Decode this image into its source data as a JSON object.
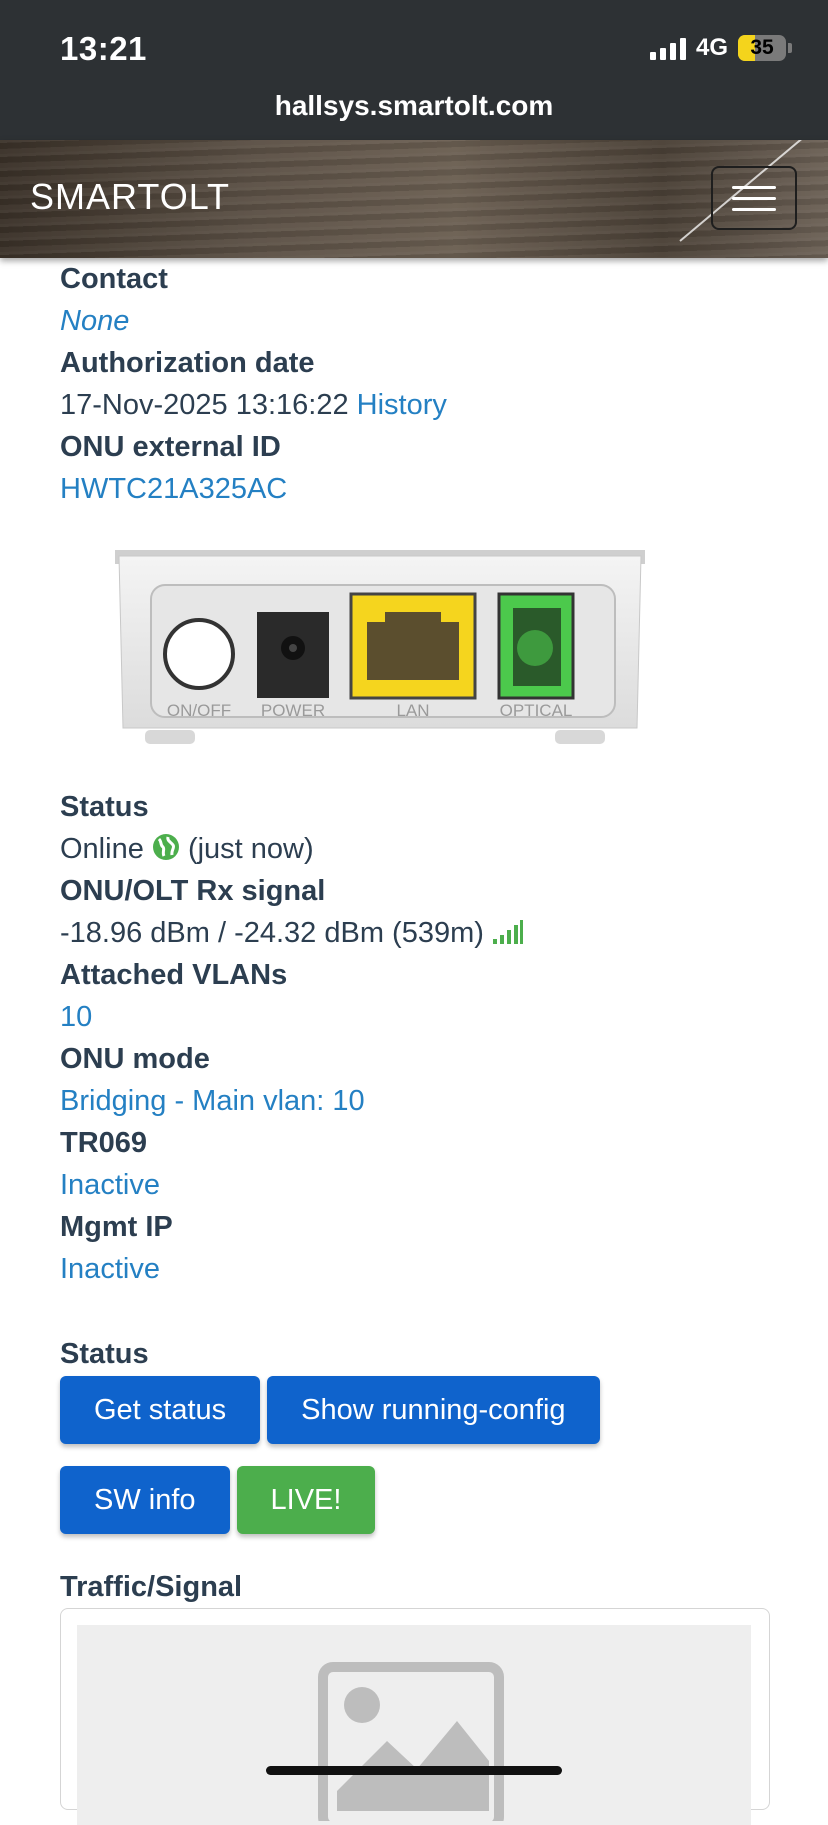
{
  "status_bar": {
    "time": "13:21",
    "network": "4G",
    "battery": "35",
    "battery_level": 0.35,
    "url": "hallsys.smartolt.com"
  },
  "navbar": {
    "brand": "SMARTOLT",
    "menu_icon": "hamburger-menu-icon"
  },
  "details": {
    "contact_label": "Contact",
    "contact_value": "None",
    "auth_date_label": "Authorization date",
    "auth_date_value": "17-Nov-2025 13:16:22",
    "history_link": "History",
    "external_id_label": "ONU external ID",
    "external_id_value": "HWTC21A325AC"
  },
  "device_image": {
    "ports": [
      "ON/OFF",
      "POWER",
      "LAN",
      "OPTICAL"
    ],
    "colors": {
      "lan": "#f5d51e",
      "optical": "#4cc94c"
    }
  },
  "status_info": {
    "status_label": "Status",
    "status_value": "Online",
    "status_time": "(just now)",
    "signal_label": "ONU/OLT Rx signal",
    "signal_value": "-18.96 dBm / -24.32 dBm (539m)",
    "vlans_label": "Attached VLANs",
    "vlans_value": "10",
    "mode_label": "ONU mode",
    "mode_value": "Bridging - Main vlan: 10",
    "tr069_label": "TR069",
    "tr069_value": "Inactive",
    "mgmt_label": "Mgmt IP",
    "mgmt_value": "Inactive"
  },
  "actions": {
    "section_label": "Status",
    "get_status": "Get status",
    "show_running_config": "Show running-config",
    "sw_info": "SW info",
    "live": "LIVE!"
  },
  "traffic": {
    "section_label": "Traffic/Signal"
  },
  "colors": {
    "link": "#2480c3",
    "primary_button": "#0f63cc",
    "success_button": "#4cae4c",
    "signal_green": "#4cae4c"
  }
}
